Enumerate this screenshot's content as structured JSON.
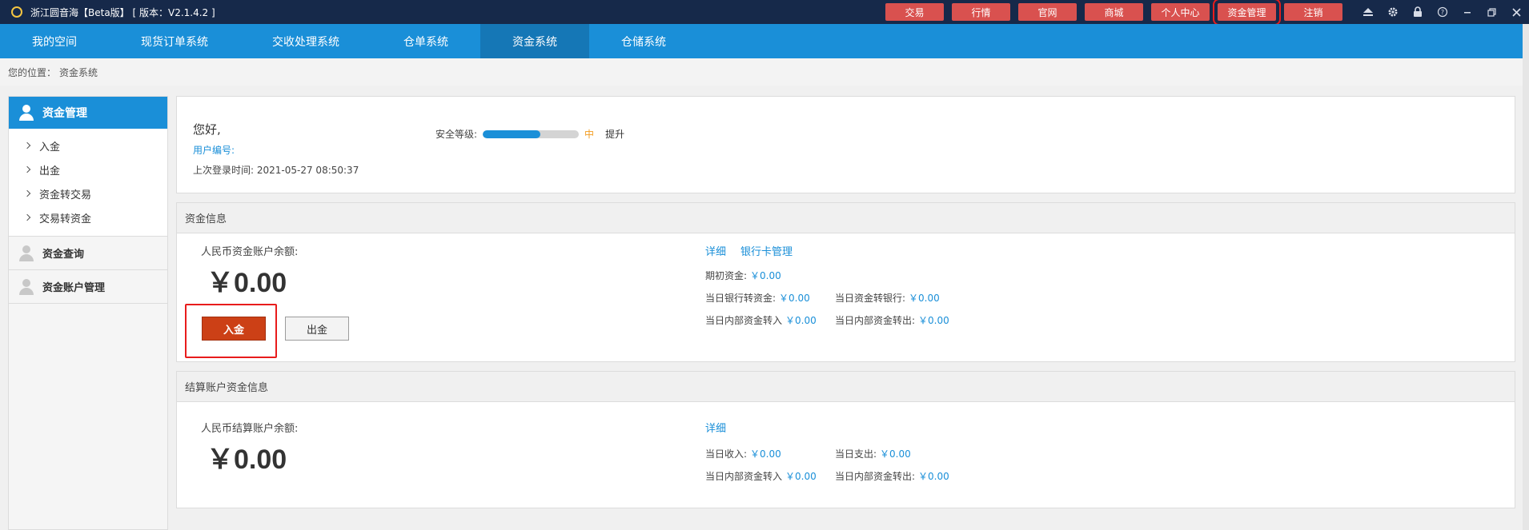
{
  "titlebar": {
    "title": "浙江圆音海【Beta版】 [ 版本：V2.1.4.2 ]",
    "buttons": [
      "交易",
      "行情",
      "官网",
      "商城",
      "个人中心",
      "资金管理",
      "注销"
    ],
    "highlighted_button": "资金管理",
    "window_icons": [
      "eject-icon",
      "gear-icon",
      "lock-icon",
      "help-icon",
      "minimize-icon",
      "restore-icon",
      "close-icon"
    ]
  },
  "nav": {
    "items": [
      "我的空间",
      "现货订单系统",
      "交收处理系统",
      "仓单系统",
      "资金系统",
      "仓储系统"
    ],
    "active": "资金系统"
  },
  "breadcrumb": {
    "prefix": "您的位置：",
    "current": "资金系统"
  },
  "sidebar": {
    "header": "资金管理",
    "links": [
      "入金",
      "出金",
      "资金转交易",
      "交易转资金"
    ],
    "sections": [
      "资金查询",
      "资金账户管理"
    ]
  },
  "user": {
    "greeting": "您好,",
    "user_id_label": "用户编号:",
    "last_login_label": "上次登录时间:",
    "last_login_time": "2021-05-27 08:50:37",
    "security_label": "安全等级:",
    "security_level": "中",
    "security_fraction": 0.6,
    "upgrade": "提升"
  },
  "funds": {
    "title": "资金信息",
    "balance_label": "人民币资金账户余额:",
    "balance": "￥0.00",
    "deposit_button": "入金",
    "withdraw_button": "出金",
    "links": [
      "详细",
      "银行卡管理"
    ],
    "opening_label": "期初资金:",
    "opening_value": "￥0.00",
    "bank_to_fund_label": "当日银行转资金:",
    "bank_to_fund_value": "￥0.00",
    "fund_to_bank_label": "当日资金转银行:",
    "fund_to_bank_value": "￥0.00",
    "internal_in_label": "当日内部资金转入",
    "internal_in_value": "￥0.00",
    "internal_out_label": "当日内部资金转出:",
    "internal_out_value": "￥0.00"
  },
  "settlement": {
    "title": "结算账户资金信息",
    "balance_label": "人民币结算账户余额:",
    "balance": "￥0.00",
    "link": "详细",
    "income_label": "当日收入:",
    "income_value": "￥0.00",
    "expense_label": "当日支出:",
    "expense_value": "￥0.00",
    "internal_in_label": "当日内部资金转入",
    "internal_in_value": "￥0.00",
    "internal_out_label": "当日内部资金转出:",
    "internal_out_value": "￥0.00"
  },
  "colors": {
    "titlebar": "#16294a",
    "nav": "#1a8fd8",
    "nav_active": "#1577b6",
    "red_button": "#d9514f",
    "deposit": "#cc4016",
    "link": "#1a8fd8",
    "highlight_box": "#e81c1c"
  }
}
